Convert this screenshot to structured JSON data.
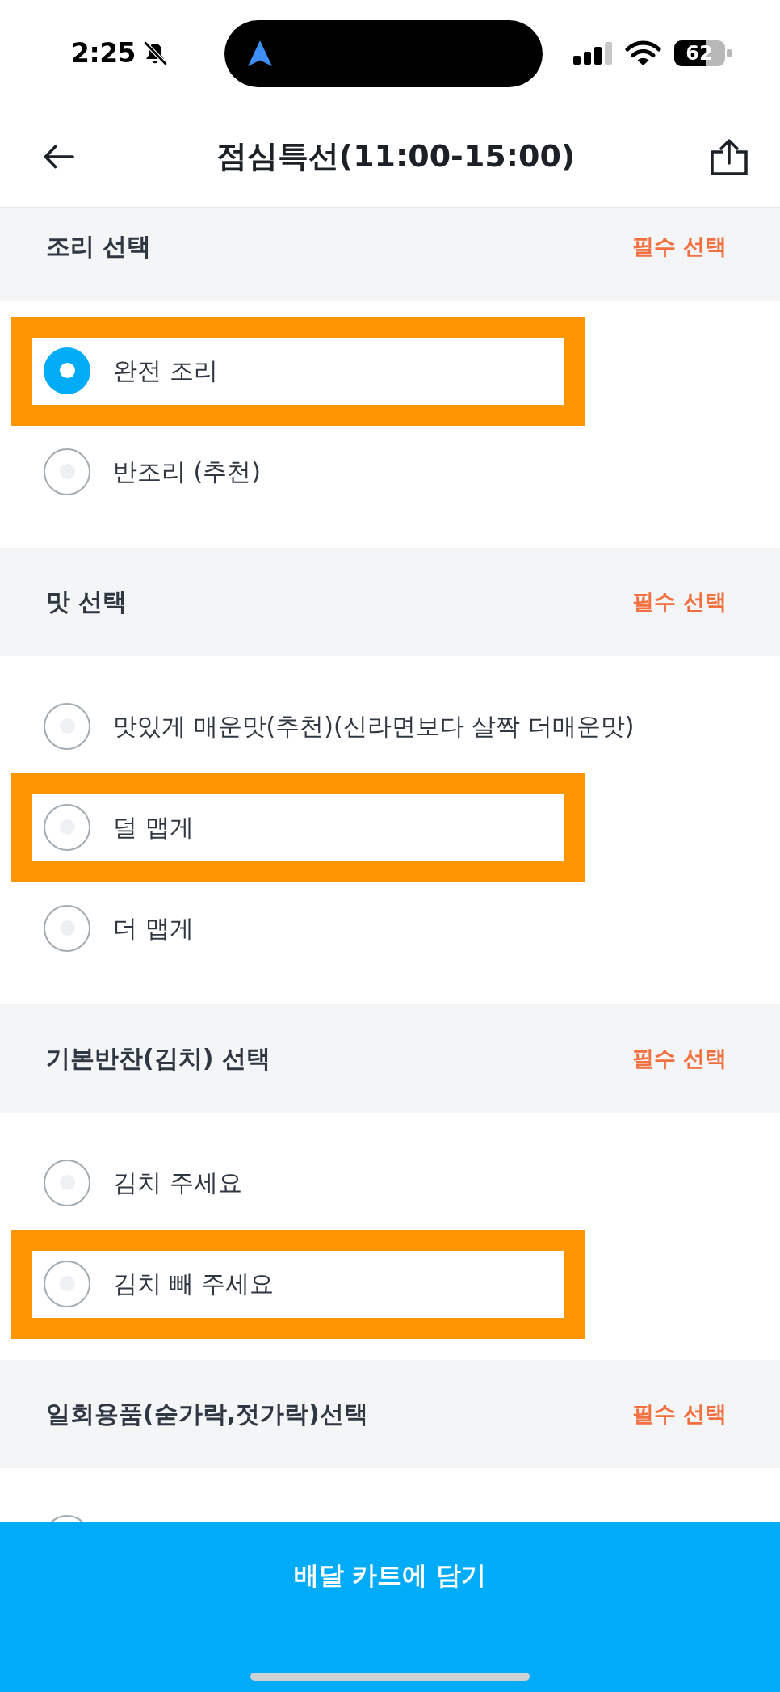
{
  "status_bar": {
    "time": "2:25",
    "battery": "62"
  },
  "header": {
    "title": "점심특선(11:00-15:00)"
  },
  "sections": [
    {
      "title": "조리 선택",
      "badge": "필수 선택",
      "options": [
        {
          "label": "완전 조리",
          "selected": true,
          "highlighted": true
        },
        {
          "label": "반조리 (추천)",
          "selected": false,
          "highlighted": false
        }
      ]
    },
    {
      "title": "맛 선택",
      "badge": "필수 선택",
      "options": [
        {
          "label": "맛있게 매운맛(추천)(신라면보다 살짝 더매운맛)",
          "selected": false,
          "highlighted": false
        },
        {
          "label": "덜 맵게",
          "selected": false,
          "highlighted": true
        },
        {
          "label": "더 맵게",
          "selected": false,
          "highlighted": false
        }
      ]
    },
    {
      "title": "기본반찬(김치) 선택",
      "badge": "필수 선택",
      "options": [
        {
          "label": "김치 주세요",
          "selected": false,
          "highlighted": false
        },
        {
          "label": "김치 빼 주세요",
          "selected": false,
          "highlighted": true
        }
      ]
    },
    {
      "title": "일회용품(숟가락,젓가락)선택",
      "badge": "필수 선택",
      "options": [
        {
          "selected": false,
          "highlighted": false
        }
      ]
    }
  ],
  "cart_button": {
    "label": "배달 카트에 담기"
  }
}
